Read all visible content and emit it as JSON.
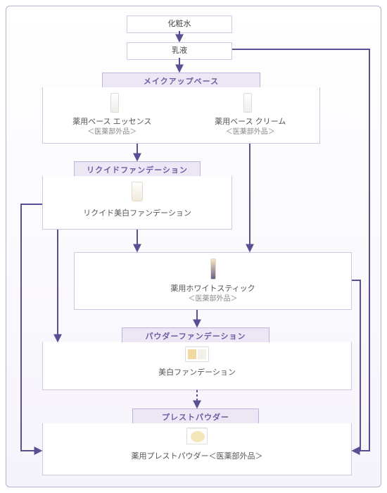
{
  "steps": {
    "lotion": "化粧水",
    "emulsion": "乳液"
  },
  "categories": {
    "makeup_base": "メイクアップベース",
    "liquid_foundation": "リクイドファンデーション",
    "powder_foundation": "パウダーファンデーション",
    "pressed_powder": "プレストパウダー"
  },
  "products": {
    "base_essence_name": "薬用ベース エッセンス",
    "base_essence_note": "＜医薬部外品＞",
    "base_cream_name": "薬用ベース クリーム",
    "base_cream_note": "＜医薬部外品＞",
    "liquid_foundation_name": "リクイド美白ファンデーション",
    "white_stick_name": "薬用ホワイトスティック",
    "white_stick_note": "＜医薬部外品＞",
    "powder_foundation_name": "美白ファンデーション",
    "pressed_powder_name": "薬用プレストパウダー＜医薬部外品＞"
  }
}
